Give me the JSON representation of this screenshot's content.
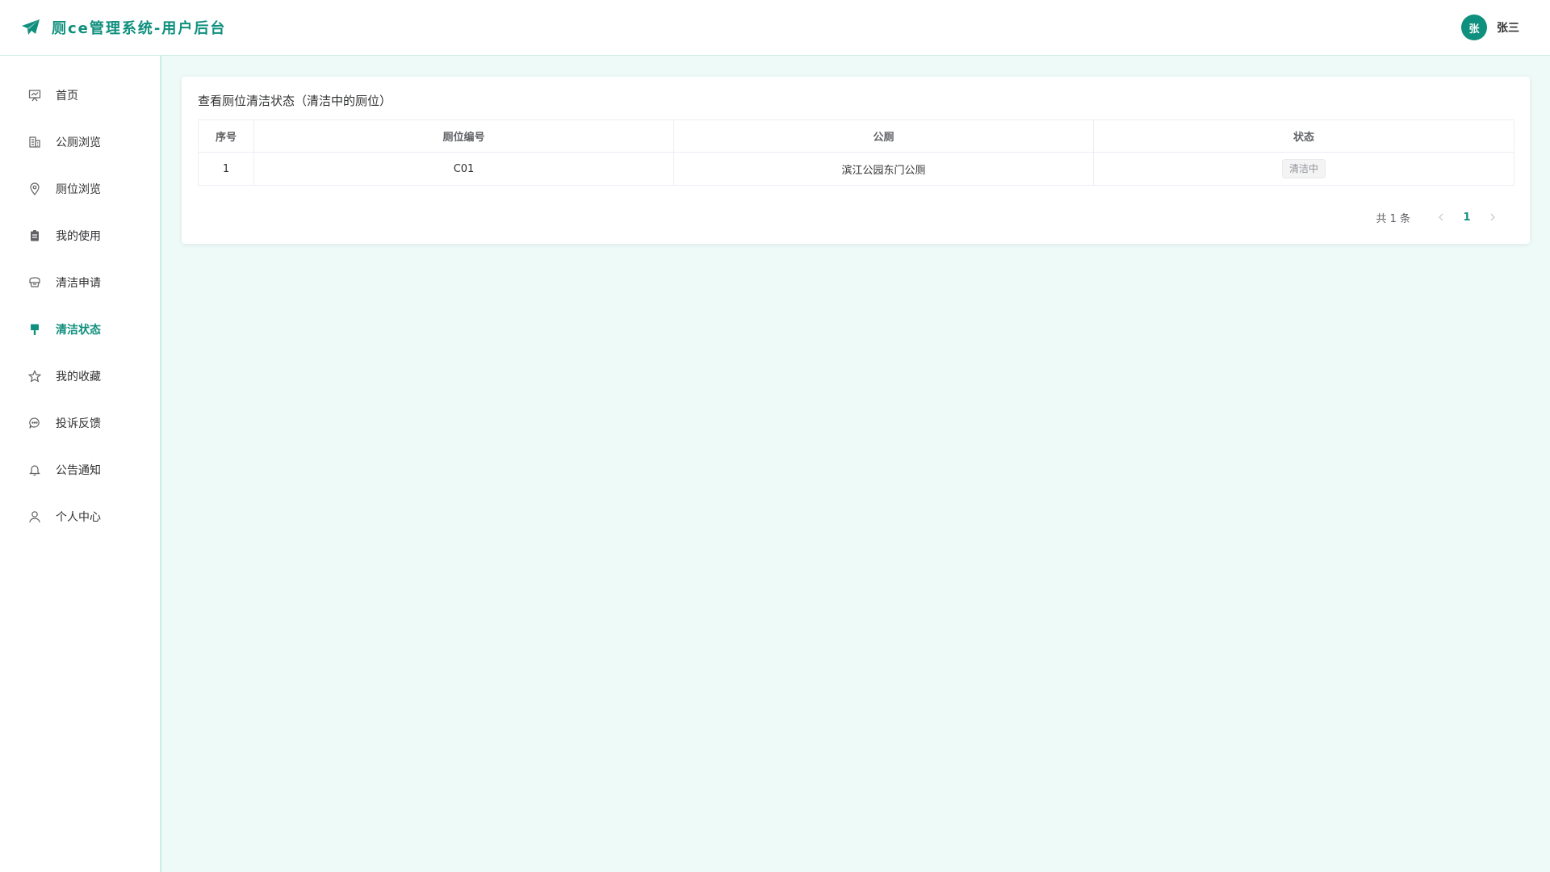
{
  "header": {
    "brand_title": "厕ce管理系统-用户后台",
    "brand_icon": "paper-plane-icon",
    "user_avatar_text": "张",
    "user_name": "张三",
    "accent_color": "#0f8f7d"
  },
  "sidebar": {
    "items": [
      {
        "label": "首页",
        "icon": "presentation-icon",
        "active": false
      },
      {
        "label": "公厕浏览",
        "icon": "building-icon",
        "active": false
      },
      {
        "label": "厕位浏览",
        "icon": "location-pin-icon",
        "active": false
      },
      {
        "label": "我的使用",
        "icon": "clipboard-icon",
        "active": false
      },
      {
        "label": "清洁申请",
        "icon": "cleaning-cart-icon",
        "active": false
      },
      {
        "label": "清洁状态",
        "icon": "paint-brush-icon",
        "active": true
      },
      {
        "label": "我的收藏",
        "icon": "star-icon",
        "active": false
      },
      {
        "label": "投诉反馈",
        "icon": "chat-bubble-icon",
        "active": false
      },
      {
        "label": "公告通知",
        "icon": "bell-icon",
        "active": false
      },
      {
        "label": "个人中心",
        "icon": "user-icon",
        "active": false
      }
    ]
  },
  "main": {
    "card_title": "查看厕位清洁状态（清洁中的厕位）",
    "table": {
      "headers": [
        "序号",
        "厕位编号",
        "公厕",
        "状态"
      ],
      "rows": [
        {
          "index": "1",
          "code": "C01",
          "toilet": "滨江公园东门公厕",
          "status": "清洁中"
        }
      ]
    },
    "pagination": {
      "total_text": "共 1 条",
      "current_page": "1"
    }
  }
}
